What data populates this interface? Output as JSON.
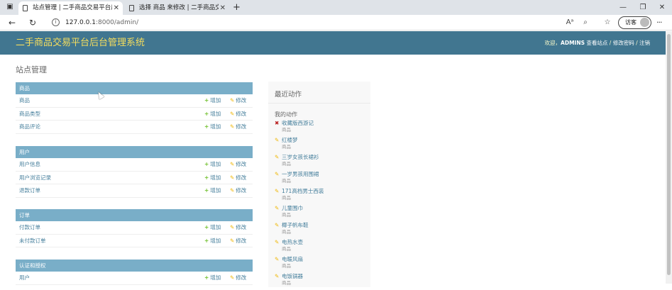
{
  "browser": {
    "tabs": [
      {
        "title": "站点管理 | 二手商品交易平台后台"
      },
      {
        "title": "选择 商品 来修改 | 二手商品交易"
      }
    ],
    "new_tab": "+",
    "url_host": "127.0.0.1",
    "url_rest": ":8000/admin/",
    "guest_label": "访客",
    "more": "···"
  },
  "header": {
    "brand": "二手商品交易平台后台管理系统",
    "welcome": "欢迎，",
    "username": "ADMINS",
    "view_site": "查看站点",
    "change_password": "修改密码",
    "logout": "注销",
    "separator": " / "
  },
  "page": {
    "title": "站点管理"
  },
  "actions": {
    "add": "增加",
    "change": "修改"
  },
  "modules": [
    {
      "caption": "商品",
      "items": [
        "商品",
        "商品类型",
        "商品评论"
      ]
    },
    {
      "caption": "用户",
      "items": [
        "用户信息",
        "用户浏览记录",
        "退款订单"
      ]
    },
    {
      "caption": "订单",
      "items": [
        "付款订单",
        "未付款订单"
      ]
    },
    {
      "caption": "认证和授权",
      "items": [
        "用户"
      ]
    }
  ],
  "recent": {
    "title": "最近动作",
    "subtitle": "我的动作",
    "entries": [
      {
        "title": "收藏版西游记",
        "type": "商品",
        "kind": "deletion"
      },
      {
        "title": "红楼梦",
        "type": "商品",
        "kind": "change"
      },
      {
        "title": "三岁女孩长裙衫",
        "type": "商品",
        "kind": "change"
      },
      {
        "title": "一岁男孩用围裙",
        "type": "商品",
        "kind": "change"
      },
      {
        "title": "171高档男士西装",
        "type": "商品",
        "kind": "change"
      },
      {
        "title": "儿童围巾",
        "type": "商品",
        "kind": "change"
      },
      {
        "title": "椰子帆布鞋",
        "type": "商品",
        "kind": "change"
      },
      {
        "title": "电热水壶",
        "type": "商品",
        "kind": "change"
      },
      {
        "title": "电暖风扇",
        "type": "商品",
        "kind": "change"
      },
      {
        "title": "电饭锅器",
        "type": "商品",
        "kind": "change"
      }
    ]
  },
  "colors": {
    "header_bg": "#417690",
    "brand": "#f5dd5d",
    "caption_bg": "#79aec8",
    "link": "#447e9b",
    "add_icon": "#70bf2b",
    "change_icon": "#efb80b",
    "delete_icon": "#ba2121"
  }
}
